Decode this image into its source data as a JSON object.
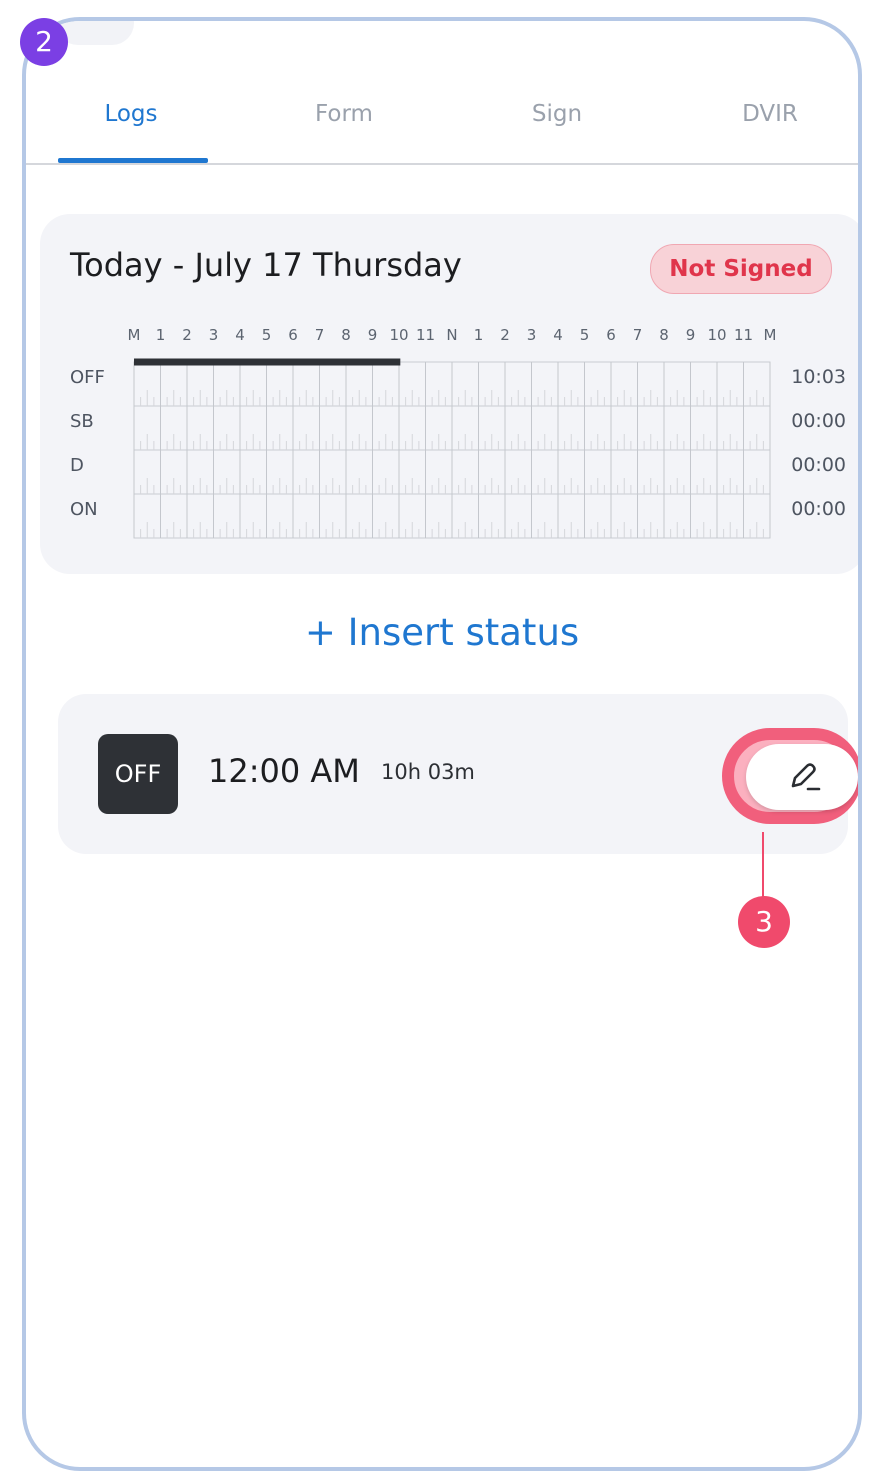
{
  "step_badges": {
    "top_left": "2",
    "edit_callout": "3"
  },
  "tabs": [
    {
      "label": "Logs",
      "active": true
    },
    {
      "label": "Form",
      "active": false
    },
    {
      "label": "Sign",
      "active": false
    },
    {
      "label": "DVIR",
      "active": false
    }
  ],
  "log_card": {
    "title": "Today - July 17 Thursday",
    "signature_badge": "Not Signed",
    "hour_labels": [
      "M",
      "1",
      "2",
      "3",
      "4",
      "5",
      "6",
      "7",
      "8",
      "9",
      "10",
      "11",
      "N",
      "1",
      "2",
      "3",
      "4",
      "5",
      "6",
      "7",
      "8",
      "9",
      "10",
      "11",
      "M"
    ],
    "rows": [
      {
        "label": "OFF",
        "total": "10:03"
      },
      {
        "label": "SB",
        "total": "00:00"
      },
      {
        "label": "D",
        "total": "00:00"
      },
      {
        "label": "ON",
        "total": "00:00"
      }
    ],
    "status_segments": [
      {
        "status": "OFF",
        "start_hour": 0,
        "end_hour": 10.05
      }
    ]
  },
  "insert_status_label": "+ Insert status",
  "entries": [
    {
      "status": "OFF",
      "time": "12:00 AM",
      "duration": "10h 03m"
    }
  ],
  "colors": {
    "accent": "#1f77d0",
    "callout": "#f04a6c",
    "step_badge": "#7b3fe4",
    "frame": "#b5c8e6",
    "not_signed_text": "#e0354b",
    "status_off_chip": "#2e3136"
  },
  "icons": {
    "edit": "pencil-edit-icon"
  }
}
